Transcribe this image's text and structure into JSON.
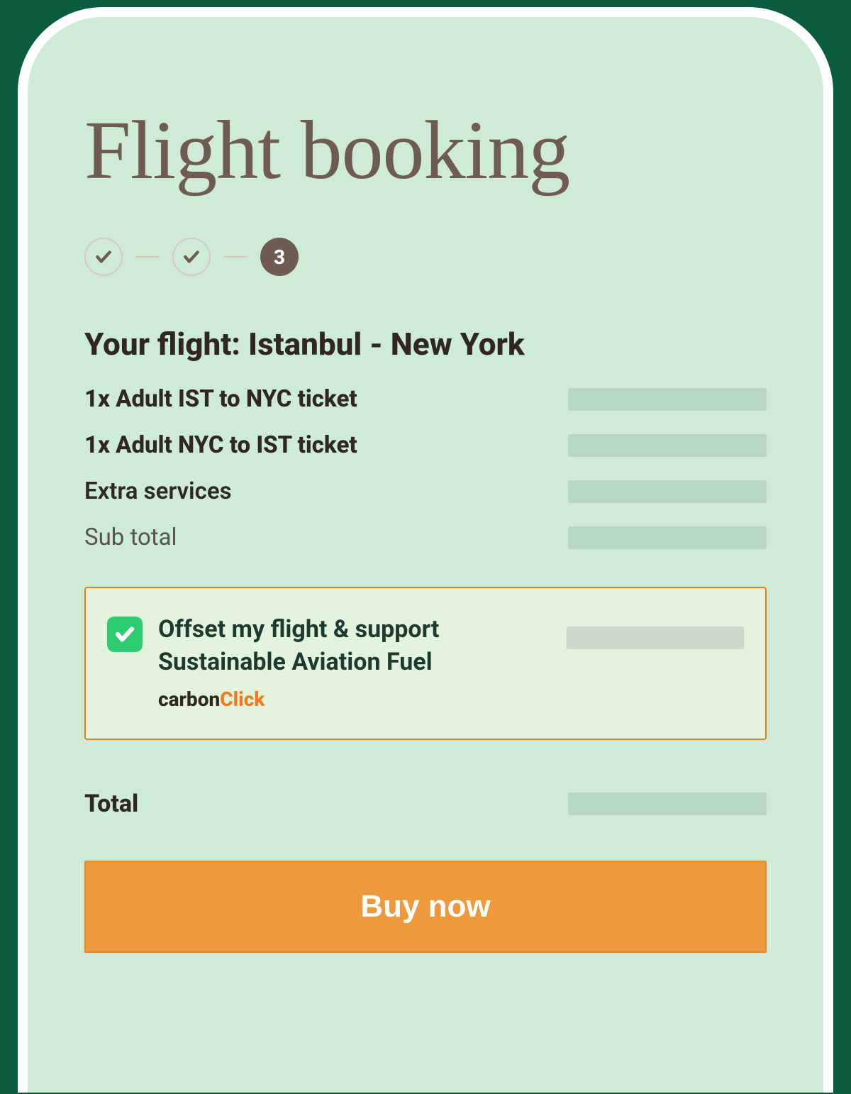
{
  "title": "Flight booking",
  "stepper": {
    "current_label": "3"
  },
  "route": "Your flight: Istanbul - New York",
  "lines": [
    {
      "label": "1x Adult IST to NYC  ticket"
    },
    {
      "label": "1x Adult NYC to IST ticket"
    },
    {
      "label": "Extra services"
    },
    {
      "label": "Sub total"
    }
  ],
  "offset": {
    "text": "Offset my flight & support Sustainable Aviation Fuel",
    "brand_part1": "carbon",
    "brand_part2": "Click"
  },
  "total_label": "Total",
  "cta": "Buy now"
}
